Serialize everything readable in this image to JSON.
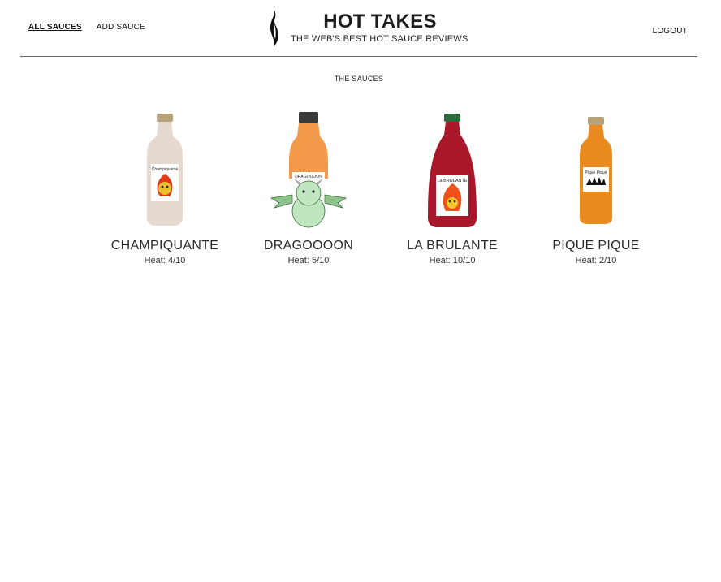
{
  "header": {
    "nav": {
      "all_sauces": "ALL SAUCES",
      "add_sauce": "ADD SAUCE",
      "logout": "LOGOUT"
    },
    "brand": {
      "title": "HOT TAKES",
      "subtitle": "THE WEB'S BEST HOT SAUCE REVIEWS",
      "logo_icon": "flame-icon"
    }
  },
  "main": {
    "section_title": "THE SAUCES",
    "sauces": [
      {
        "name": "CHAMPIQUANTE",
        "heat_label": "Heat: 4/10",
        "label_text": "Champiquante",
        "bottle_color": "#e6d9cf",
        "cap_color": "#b8a27a"
      },
      {
        "name": "DRAGOOOON",
        "heat_label": "Heat: 5/10",
        "label_text": "DRAGOOOON",
        "bottle_color": "#f29a4a",
        "cap_color": "#3a3a3a"
      },
      {
        "name": "LA BRULANTE",
        "heat_label": "Heat: 10/10",
        "label_text": "La BRULANTE",
        "bottle_color": "#a8182a",
        "cap_color": "#2f6b3a"
      },
      {
        "name": "PIQUE PIQUE",
        "heat_label": "Heat: 2/10",
        "label_text": "Pique Pique",
        "bottle_color": "#e98a1f",
        "cap_color": "#b8a27a"
      }
    ]
  }
}
